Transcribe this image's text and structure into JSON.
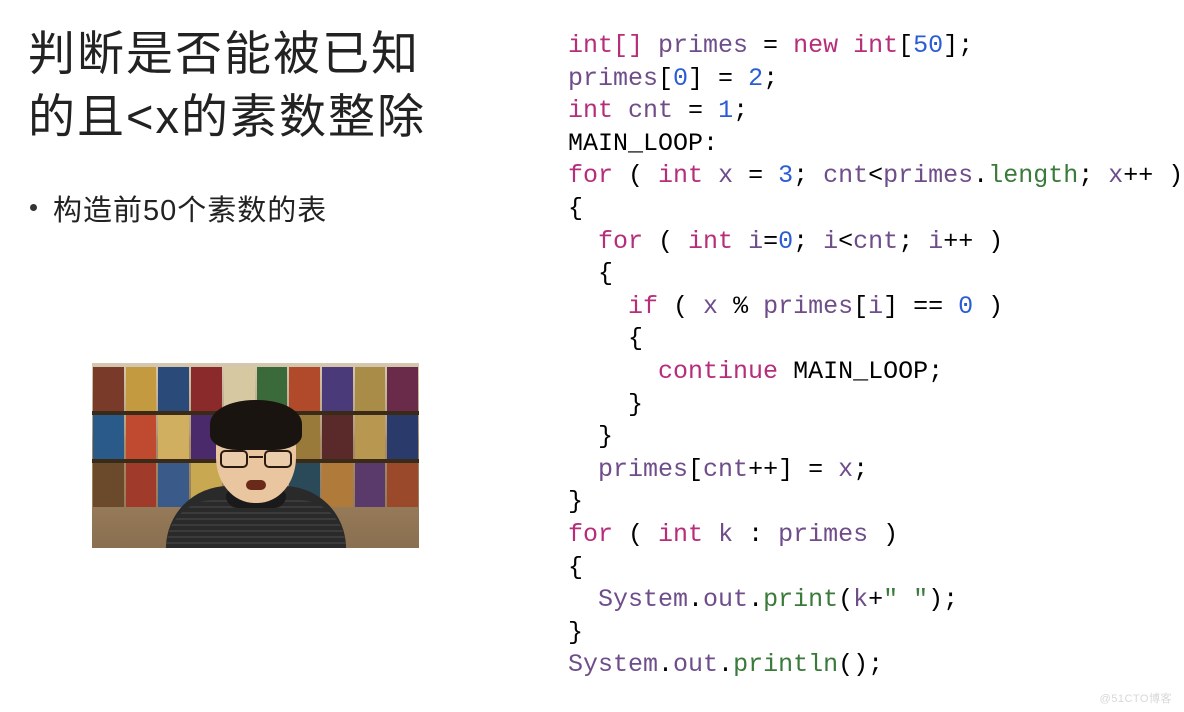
{
  "title_lines": [
    "判断是否能被已知",
    "的且<x的素数整除"
  ],
  "bullet": "构造前50个素数的表",
  "code": {
    "ty_int_arr": "int[]",
    "ty_int": "int",
    "kw_new": "new",
    "kw_for": "for",
    "kw_if": "if",
    "kw_continue": "continue",
    "id_primes": "primes",
    "id_cnt": "cnt",
    "id_x": "x",
    "id_i": "i",
    "id_k": "k",
    "id_system": "System",
    "id_out": "out",
    "fn_length": "length",
    "fn_print": "print",
    "fn_println": "println",
    "lbl_main": "MAIN_LOOP",
    "n50": "50",
    "n0": "0",
    "n2": "2",
    "n1": "1",
    "n3": "3",
    "s_space": "\" \""
  },
  "watermark": "@51CTO博客"
}
